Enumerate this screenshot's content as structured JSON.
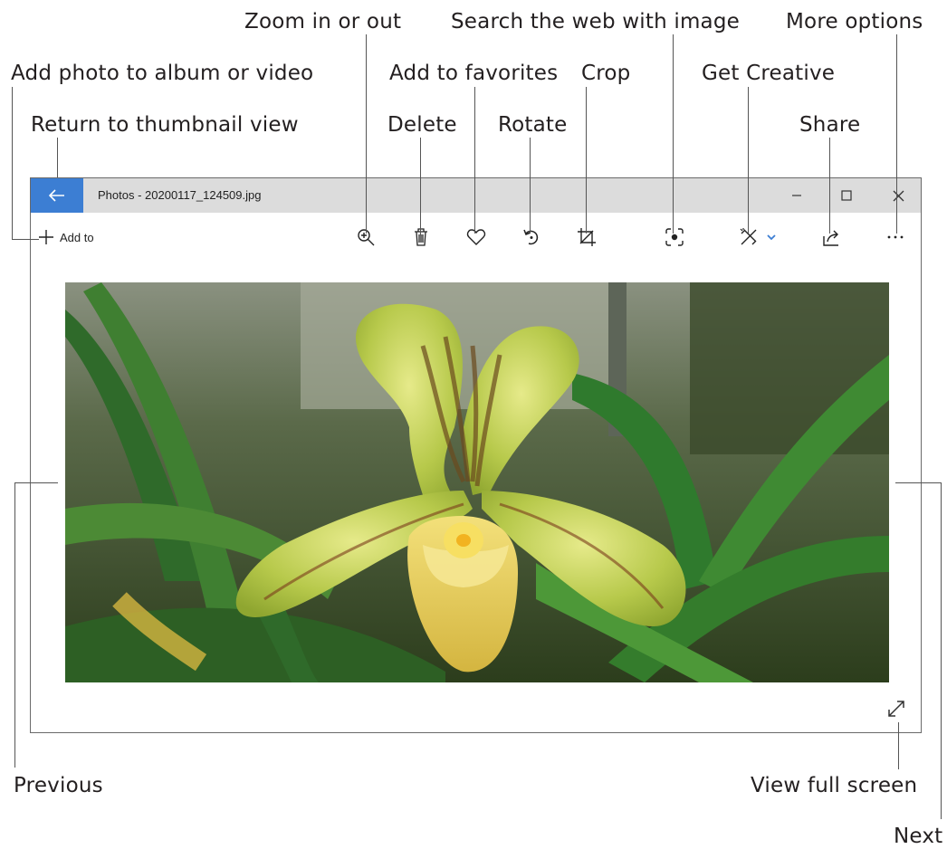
{
  "window": {
    "title": "Photos - 20200117_124509.jpg",
    "accent_color": "#3c7ed3",
    "controls": [
      "minimize-icon",
      "maximize-icon",
      "close-icon"
    ]
  },
  "toolbar": {
    "add_to_label": "Add to",
    "buttons": [
      "plus-icon",
      "zoom-icon",
      "delete-icon",
      "heart-icon",
      "rotate-icon",
      "crop-icon",
      "visual-search-icon",
      "get-creative-icon",
      "chevron-down-icon",
      "share-icon",
      "more-options-icon"
    ]
  },
  "callouts": {
    "zoom": "Zoom in or out",
    "search_web": "Search the web with image",
    "more_options": "More options",
    "add_photo": "Add photo to album or video",
    "add_favorites": "Add to favorites",
    "crop": "Crop",
    "get_creative": "Get Creative",
    "return_thumbnail": "Return to thumbnail view",
    "delete": "Delete",
    "rotate": "Rotate",
    "share": "Share",
    "previous": "Previous",
    "view_full_screen": "View full screen",
    "next": "Next"
  },
  "photo": {
    "subject": "orchid-photo"
  }
}
